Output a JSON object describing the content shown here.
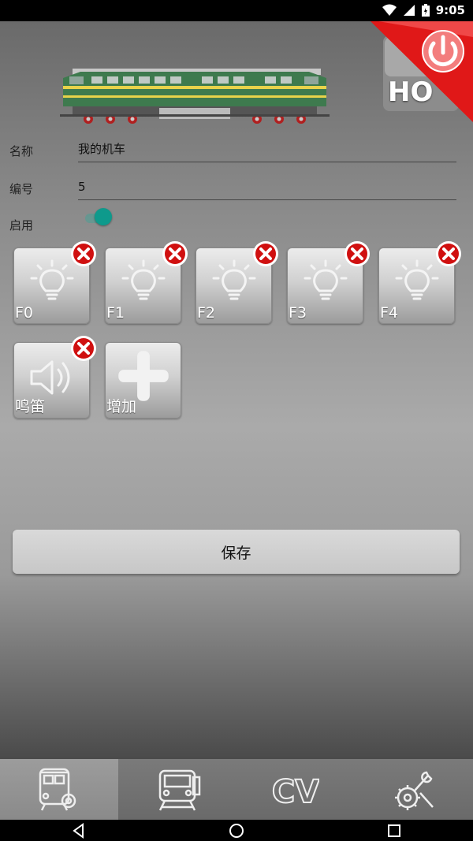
{
  "status_bar": {
    "time": "9:05",
    "icons": [
      "wifi-icon",
      "signal-icon",
      "battery-icon"
    ]
  },
  "badge": {
    "scale": "HO"
  },
  "form": {
    "name_label": "名称",
    "name_value": "我的机车",
    "number_label": "编号",
    "number_value": "5",
    "enable_label": "启用",
    "enabled": true
  },
  "functions": [
    {
      "label": "F0",
      "icon": "lightbulb-icon"
    },
    {
      "label": "F1",
      "icon": "lightbulb-icon"
    },
    {
      "label": "F2",
      "icon": "lightbulb-icon"
    },
    {
      "label": "F3",
      "icon": "lightbulb-icon"
    },
    {
      "label": "F4",
      "icon": "lightbulb-icon"
    },
    {
      "label": "鸣笛",
      "icon": "speaker-icon"
    }
  ],
  "add_button": {
    "label": "增加"
  },
  "save_button": {
    "label": "保存"
  },
  "tabs": [
    {
      "icon": "train-settings-icon",
      "active": true
    },
    {
      "icon": "train-icon",
      "active": false
    },
    {
      "icon": "cv-icon",
      "text": "CV",
      "active": false
    },
    {
      "icon": "tools-icon",
      "active": false
    }
  ],
  "colors": {
    "toggle_accent": "#0e9a8c",
    "delete_red": "#d01010",
    "badge_red": "#e01818"
  }
}
